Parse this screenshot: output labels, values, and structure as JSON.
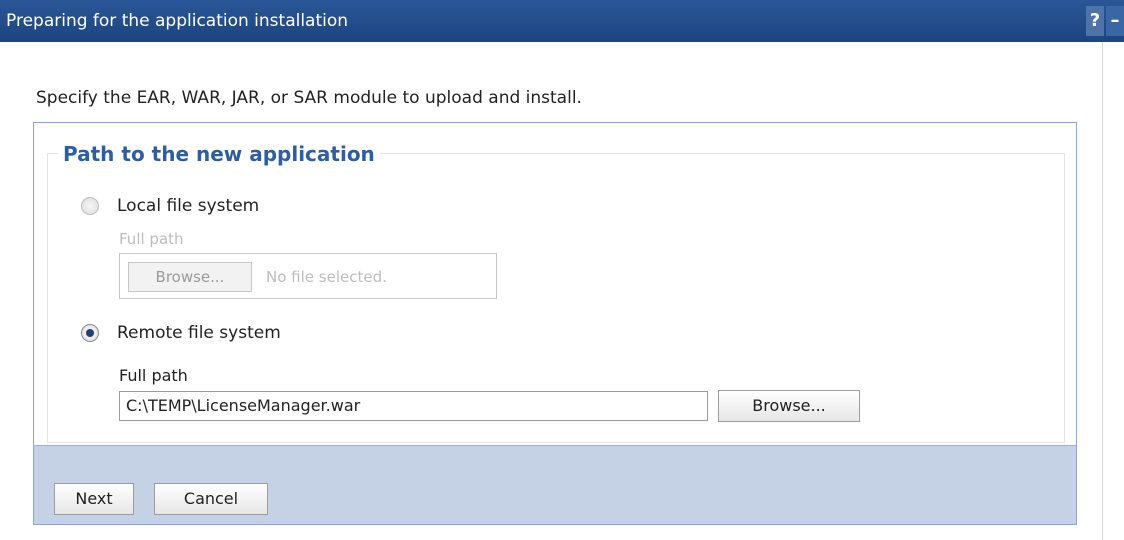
{
  "header": {
    "title": "Preparing for the application installation",
    "help_label": "?",
    "minimize_label": "–"
  },
  "instruction": "Specify the EAR, WAR, JAR, or SAR module to upload and install.",
  "path_section": {
    "legend": "Path to the new application",
    "local": {
      "label": "Local file system",
      "full_path_label": "Full path",
      "browse_label": "Browse...",
      "no_file_text": "No file selected.",
      "selected": false,
      "disabled": true
    },
    "remote": {
      "label": "Remote file system",
      "full_path_label": "Full path",
      "value": "C:\\TEMP\\LicenseManager.war",
      "browse_label": "Browse...",
      "selected": true
    }
  },
  "actions": {
    "next_label": "Next",
    "cancel_label": "Cancel"
  },
  "colors": {
    "title_bar": "#1c447e",
    "legend_text": "#2e5da0",
    "footer_bg": "#c5d2e6"
  }
}
